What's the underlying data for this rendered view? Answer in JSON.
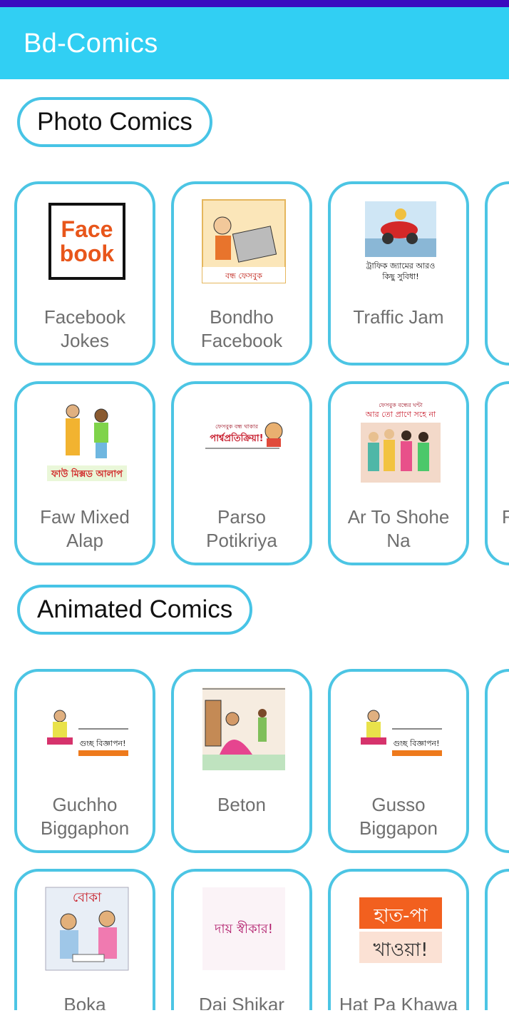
{
  "app": {
    "title": "Bd-Comics"
  },
  "sections": {
    "photo": {
      "title": "Photo Comics",
      "row1": [
        "Facebook\nJokes",
        "Bondho\nFacebook",
        "Traffic Jam"
      ],
      "row2": [
        "Faw Mixed\nAlap",
        "Parso\nPotikriya",
        "Ar To Shohe\nNa",
        "F"
      ]
    },
    "animated": {
      "title": "Animated Comics",
      "row1": [
        "Guchho\nBiggaphon",
        "Beton",
        "Gusso\nBiggapon"
      ],
      "row2": [
        "Boka",
        "Dai Shikar",
        "Hat Pa Khawa"
      ]
    }
  },
  "thumb_text": {
    "facebook": [
      "Face",
      "book"
    ],
    "bondho": "বন্ধ ফেসবুক",
    "traffic": [
      "ট্রাফিক জ্যামের আরও",
      "কিছু সুবিধা!"
    ],
    "faw": "ফাউ মিক্সড আলাপ",
    "parso_small": "ফেসবুক বন্ধ থাকার",
    "parso": "পার্শ্বপ্রতিক্রিয়া!",
    "artoshohe_small": "ফেসবুক বন্ধের ঘন্টা",
    "artoshohe": "আর তো প্রাণে সহে না",
    "guchho": "গুচ্ছ বিজ্ঞাপন!",
    "gusso": "গুচ্ছ বিজ্ঞাপন!",
    "boka": "বোকা",
    "dai": "দায় স্বীকার!",
    "hatpa": [
      "হাত-পা",
      "খাওয়া!"
    ]
  },
  "colors": {
    "status_bar": "#3a0cbf",
    "app_bar": "#31cff3",
    "accent_border": "#4cc5e4",
    "label_text": "#6f6f6f"
  }
}
